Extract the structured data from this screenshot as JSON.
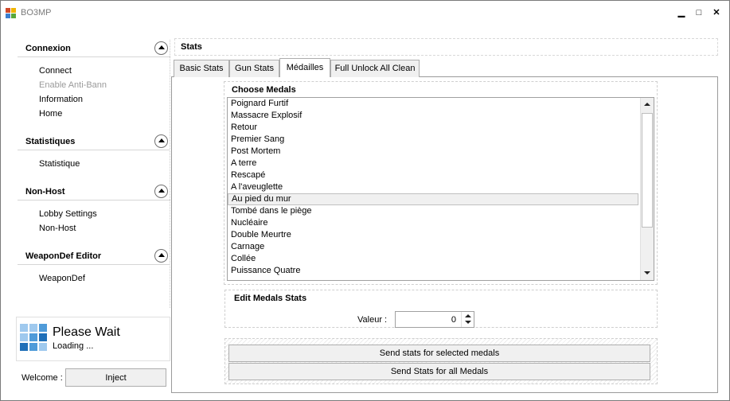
{
  "window": {
    "title": "BO3MP",
    "minimize_glyph": "▁",
    "maximize_glyph": "□",
    "close_glyph": "✕"
  },
  "sidebar": {
    "sections": [
      {
        "title": "Connexion",
        "items": [
          {
            "label": "Connect",
            "disabled": false
          },
          {
            "label": "Enable Anti-Bann",
            "disabled": true
          },
          {
            "label": "Information",
            "disabled": false
          },
          {
            "label": "Home",
            "disabled": false
          }
        ]
      },
      {
        "title": "Statistiques",
        "items": [
          {
            "label": "Statistique",
            "disabled": false
          }
        ]
      },
      {
        "title": "Non-Host",
        "items": [
          {
            "label": "Lobby Settings",
            "disabled": false
          },
          {
            "label": "Non-Host",
            "disabled": false
          }
        ]
      },
      {
        "title": "WeaponDef Editor",
        "items": [
          {
            "label": "WeaponDef",
            "disabled": false
          }
        ]
      }
    ]
  },
  "status": {
    "title": "Please Wait",
    "subtitle": "Loading ..."
  },
  "footer": {
    "welcome_label": "Welcome :",
    "inject_label": "Inject"
  },
  "main": {
    "header": "Stats",
    "tabs": [
      {
        "label": "Basic Stats"
      },
      {
        "label": "Gun Stats"
      },
      {
        "label": "Médailles"
      },
      {
        "label": "Full Unlock All Clean"
      }
    ],
    "active_tab": "Médailles",
    "choose_medals": {
      "title": "Choose Medals",
      "items": [
        "Poignard Furtif",
        "Massacre Explosif",
        "Retour",
        "Premier Sang",
        "Post Mortem",
        "A terre",
        "Rescapé",
        "A l'aveuglette",
        "Au pied du mur",
        "Tombé dans le piège",
        "Nucléaire",
        "Double Meurtre",
        "Carnage",
        "Collée",
        "Puissance Quatre"
      ],
      "selected": "Au pied du mur"
    },
    "edit": {
      "title": "Edit Medals Stats",
      "valeur_label": "Valeur :",
      "valeur_value": "0"
    },
    "buttons": {
      "send_selected": "Send stats for selected medals",
      "send_all": "Send Stats for all Medals"
    }
  },
  "colors": {
    "tile_light": "#9fc9ee",
    "tile_mid": "#4f9bd9",
    "tile_dark": "#1f6fb8"
  }
}
